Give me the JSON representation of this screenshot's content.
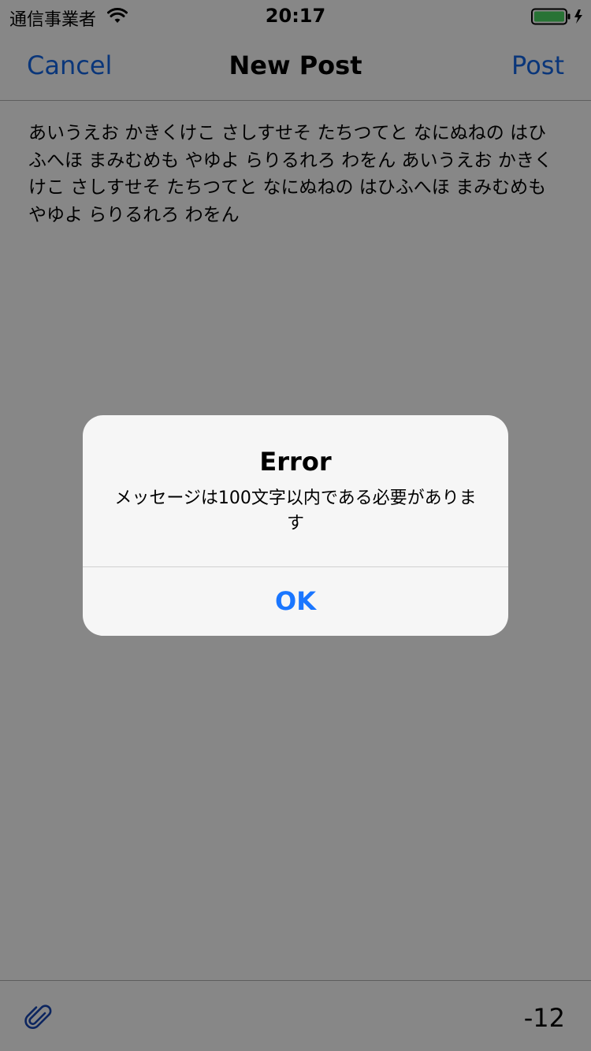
{
  "status_bar": {
    "carrier": "通信事業者",
    "time": "20:17",
    "wifi_icon": "wifi-icon",
    "battery_icon": "battery-charging-icon",
    "battery_color": "#4cd964"
  },
  "nav": {
    "cancel_label": "Cancel",
    "title": "New Post",
    "post_label": "Post",
    "accent_color": "#1366e6"
  },
  "message": {
    "text": "あいうえお かきくけこ さしすせそ たちつてと なにぬねの はひふへほ まみむめも やゆよ らりるれろ わをん あいうえお かきくけこ さしすせそ たちつてと なにぬねの はひふへほ まみむめも やゆよ らりるれろ わをん"
  },
  "toolbar": {
    "attach_icon": "paperclip-icon",
    "char_count": "-12"
  },
  "alert": {
    "title": "Error",
    "message": "メッセージは100文字以内である必要があります",
    "ok_label": "OK",
    "ok_color": "#1a76ff"
  }
}
